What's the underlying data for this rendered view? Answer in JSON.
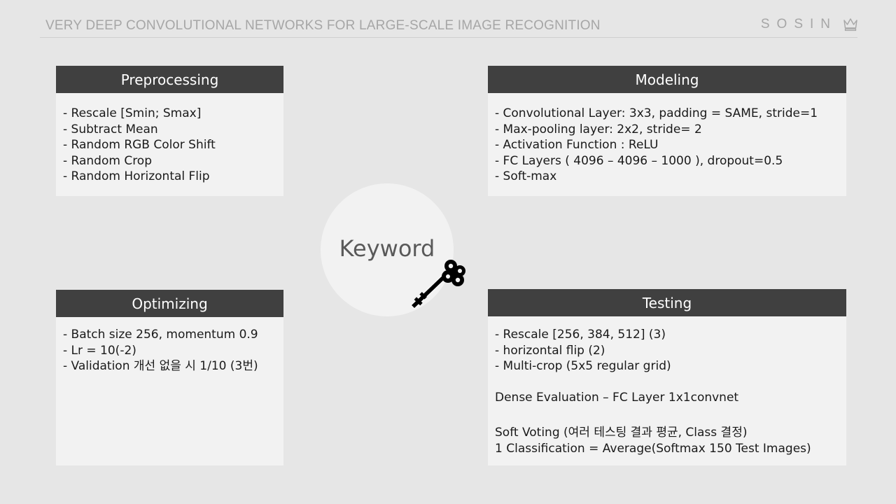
{
  "header": {
    "title": "VERY DEEP CONVOLUTIONAL NETWORKS FOR LARGE-SCALE IMAGE RECOGNITION",
    "brand": "SOSIN"
  },
  "center": {
    "label": "Keyword"
  },
  "panels": {
    "preprocessing": {
      "title": "Preprocessing",
      "items": [
        "- Rescale [Smin; Smax]",
        "- Subtract Mean",
        "- Random RGB Color Shift",
        "- Random Crop",
        "- Random Horizontal Flip"
      ]
    },
    "modeling": {
      "title": "Modeling",
      "items": [
        "- Convolutional Layer: 3x3, padding = SAME, stride=1",
        "- Max-pooling layer: 2x2, stride= 2",
        "- Activation Function : ReLU",
        "- FC Layers ( 4096 – 4096 – 1000 ), dropout=0.5",
        "- Soft-max"
      ]
    },
    "optimizing": {
      "title": "Optimizing",
      "items": [
        "- Batch size 256,  momentum 0.9",
        "- Lr = 10(-2)",
        "- Validation 개선 없을 시 1/10 (3번)"
      ]
    },
    "testing": {
      "title": "Testing",
      "items": [
        "- Rescale [256, 384, 512] (3)",
        "- horizontal flip (2)",
        "- Multi-crop (5x5 regular grid)"
      ],
      "dense": "Dense Evaluation – FC Layer 1x1convnet",
      "voting": [
        "Soft Voting (여러 테스팅 결과 평균, Class 결정)",
        "1 Classification = Average(Softmax 150 Test Images)"
      ]
    }
  },
  "colors": {
    "background": "#e6e6e6",
    "panel_header": "#404040",
    "panel_body": "#f2f2f2",
    "header_text": "#a6a6a6"
  }
}
